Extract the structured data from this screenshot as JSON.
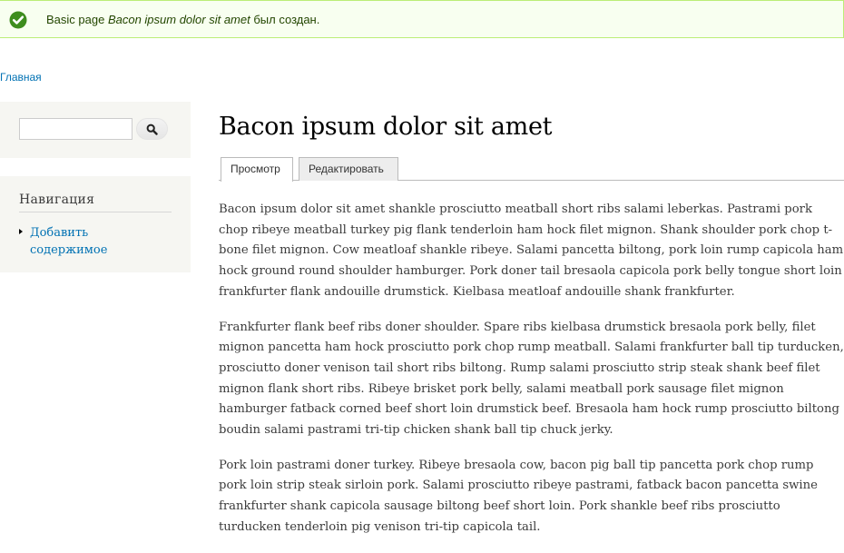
{
  "status": {
    "prefix": "Basic page ",
    "node_title": "Bacon ipsum dolor sit amet",
    "suffix": " был создан."
  },
  "breadcrumb": {
    "home_label": "Главная"
  },
  "search": {
    "value": "",
    "button_icon": "search-icon"
  },
  "navigation": {
    "title": "Навигация",
    "items": [
      {
        "label": "Добавить содержимое"
      }
    ]
  },
  "page": {
    "title": "Bacon ipsum dolor sit amet",
    "tabs": [
      {
        "label": "Просмотр",
        "active": true
      },
      {
        "label": "Редактировать",
        "active": false
      }
    ],
    "paragraphs": [
      "Bacon ipsum dolor sit amet shankle prosciutto meatball short ribs salami leberkas. Pastrami pork chop ribeye meatball turkey pig flank tenderloin ham hock filet mignon. Shank shoulder pork chop t-bone filet mignon. Cow meatloaf shankle ribeye. Salami pancetta biltong, pork loin rump capicola ham hock ground round shoulder hamburger. Pork doner tail bresaola capicola pork belly tongue short loin frankfurter flank andouille drumstick. Kielbasa meatloaf andouille shank frankfurter.",
      "Frankfurter flank beef ribs doner shoulder. Spare ribs kielbasa drumstick bresaola pork belly, filet mignon pancetta ham hock prosciutto pork chop rump meatball. Salami frankfurter ball tip turducken, prosciutto doner venison tail short ribs biltong. Rump salami prosciutto strip steak shank beef filet mignon flank short ribs. Ribeye brisket pork belly, salami meatball pork sausage filet mignon hamburger fatback corned beef short loin drumstick beef. Bresaola ham hock rump prosciutto biltong boudin salami pastrami tri-tip chicken shank ball tip chuck jerky.",
      "Pork loin pastrami doner turkey. Ribeye bresaola cow, bacon pig ball tip pancetta pork chop rump pork loin strip steak sirloin pork. Salami prosciutto ribeye pastrami, fatback bacon pancetta swine frankfurter shank capicola sausage biltong beef short loin. Pork shankle beef ribs prosciutto turducken tenderloin pig venison tri-tip capicola tail."
    ]
  },
  "colors": {
    "link": "#0071b3",
    "status_bg": "#f8fff0",
    "status_border": "#bbee77",
    "sidebar_bg": "#f6f6f2",
    "check_icon": "#3e8d1e"
  }
}
